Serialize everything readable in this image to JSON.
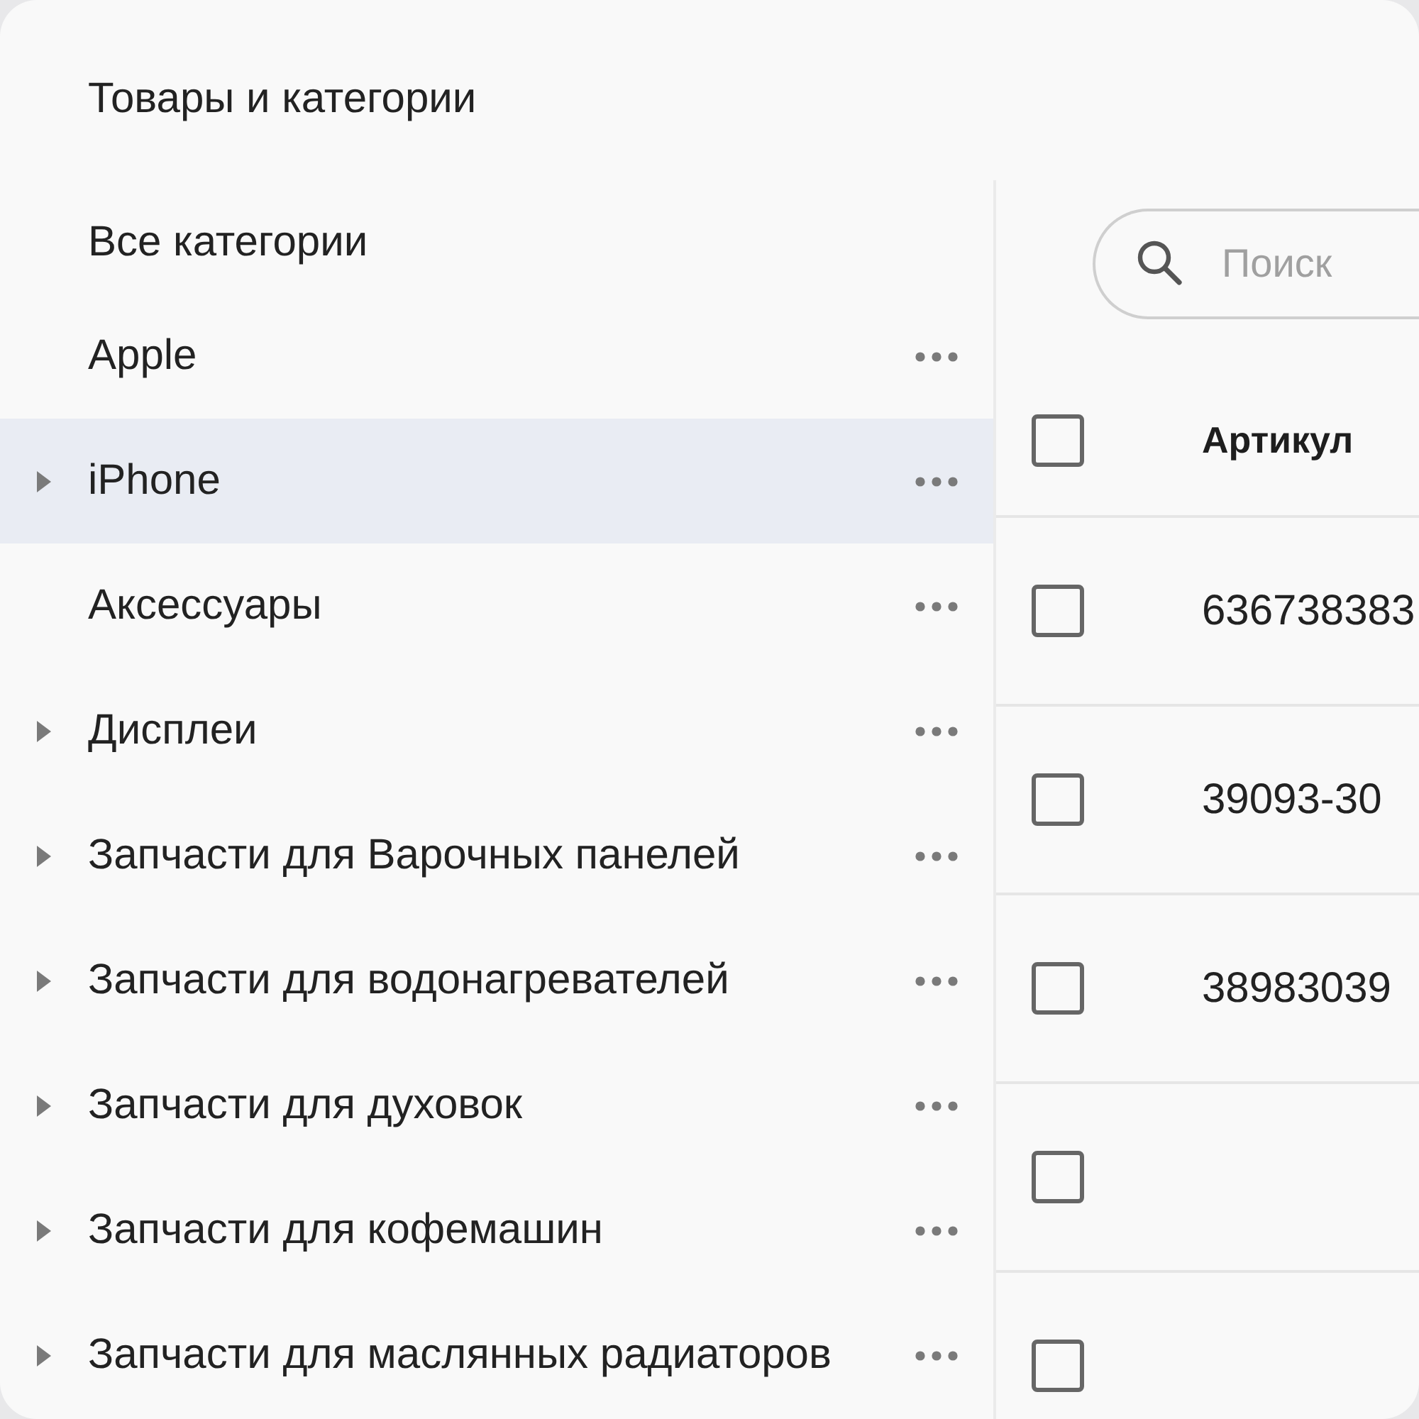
{
  "page": {
    "title": "Товары и категории"
  },
  "sidebar": {
    "items": [
      {
        "label": "Все категории",
        "expandable": false,
        "menu": false,
        "selected": false
      },
      {
        "label": "Apple",
        "expandable": false,
        "menu": true,
        "selected": false
      },
      {
        "label": "iPhone",
        "expandable": true,
        "menu": true,
        "selected": true
      },
      {
        "label": "Аксессуары",
        "expandable": false,
        "menu": true,
        "selected": false
      },
      {
        "label": "Дисплеи",
        "expandable": true,
        "menu": true,
        "selected": false
      },
      {
        "label": "Запчасти для Варочных панелей",
        "expandable": true,
        "menu": true,
        "selected": false
      },
      {
        "label": "Запчасти для водонагревателей",
        "expandable": true,
        "menu": true,
        "selected": false
      },
      {
        "label": "Запчасти для духовок",
        "expandable": true,
        "menu": true,
        "selected": false
      },
      {
        "label": "Запчасти для кофемашин",
        "expandable": true,
        "menu": true,
        "selected": false
      },
      {
        "label": "Запчасти для маслянных радиаторов",
        "expandable": true,
        "menu": true,
        "selected": false
      }
    ]
  },
  "search": {
    "placeholder": "Поиск"
  },
  "table": {
    "select_all": {
      "checked": false
    },
    "columns": [
      {
        "label": "Артикул"
      }
    ],
    "rows": [
      {
        "checked": false,
        "cells": [
          "636738383"
        ]
      },
      {
        "checked": false,
        "cells": [
          "39093-30"
        ]
      },
      {
        "checked": false,
        "cells": [
          "38983039"
        ]
      },
      {
        "checked": false
      },
      {
        "checked": false
      }
    ]
  }
}
